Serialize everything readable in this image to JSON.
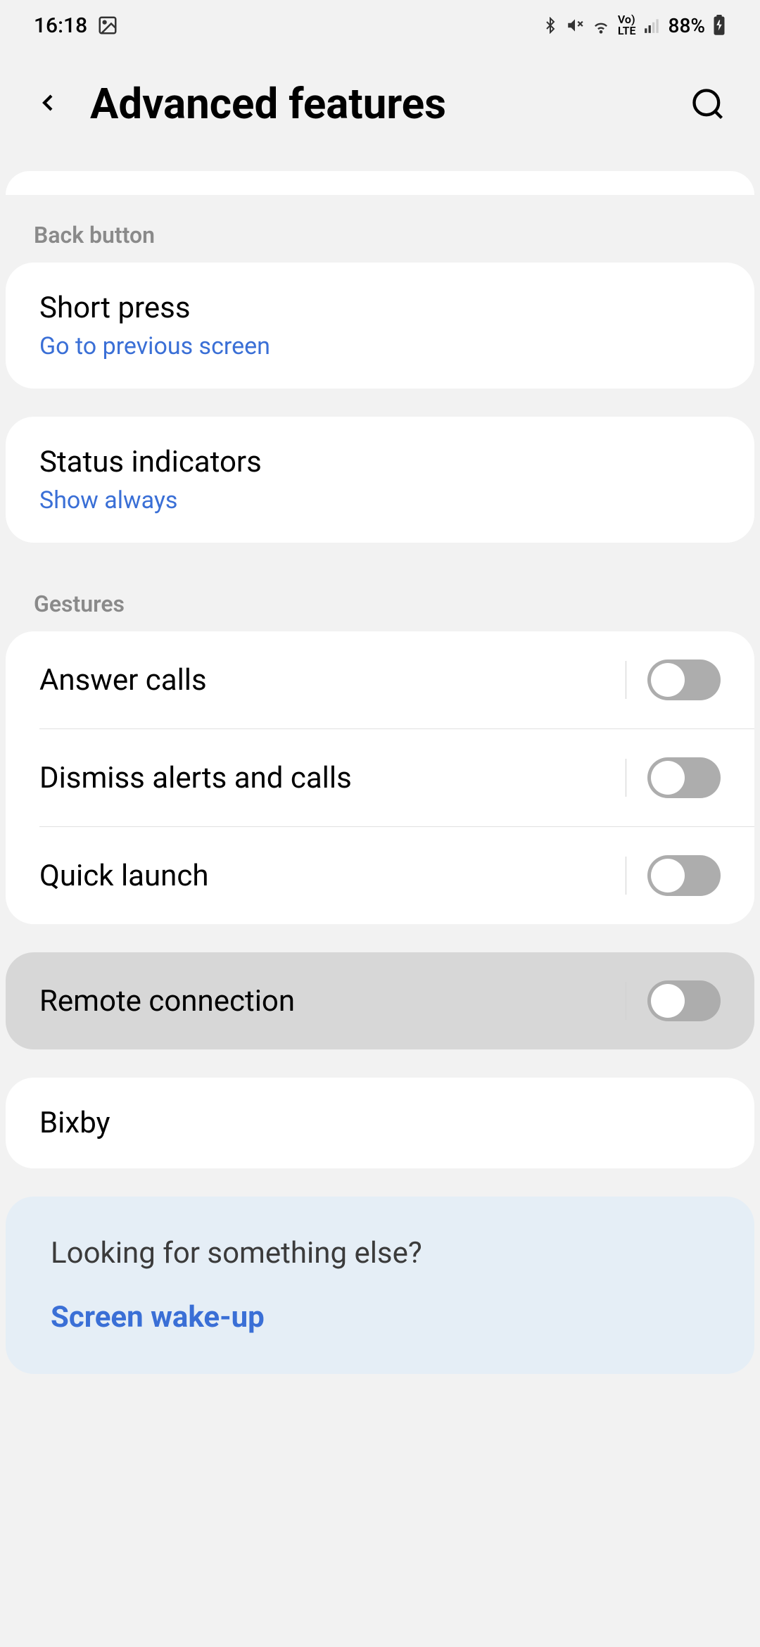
{
  "status": {
    "time": "16:18",
    "battery": "88%"
  },
  "header": {
    "title": "Advanced features"
  },
  "sections": {
    "back_button_label": "Back button",
    "gestures_label": "Gestures"
  },
  "items": {
    "short_press": {
      "title": "Short press",
      "sub": "Go to previous screen"
    },
    "status_indicators": {
      "title": "Status indicators",
      "sub": "Show always"
    },
    "answer_calls": {
      "title": "Answer calls"
    },
    "dismiss_alerts": {
      "title": "Dismiss alerts and calls"
    },
    "quick_launch": {
      "title": "Quick launch"
    },
    "remote_connection": {
      "title": "Remote connection"
    },
    "bixby": {
      "title": "Bixby"
    }
  },
  "suggestions": {
    "heading": "Looking for something else?",
    "link1": "Screen wake-up"
  }
}
